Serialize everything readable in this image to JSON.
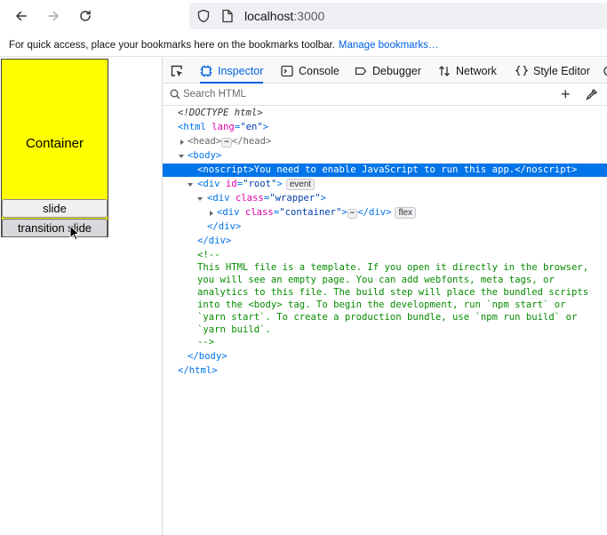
{
  "browser": {
    "url_host": "localhost",
    "url_port": ":3000",
    "bookmarks_text": "For quick access, place your bookmarks here on the bookmarks toolbar.",
    "bookmarks_link": "Manage bookmarks…"
  },
  "page": {
    "container_label": "Container",
    "slide_button": "slide",
    "transition_button": "transition slide",
    "container_color": "#ffff00"
  },
  "devtools": {
    "tabs": [
      "Inspector",
      "Console",
      "Debugger",
      "Network",
      "Style Editor"
    ],
    "active_tab": "Inspector",
    "search_placeholder": "Search HTML",
    "accent_color": "#0074e8",
    "tree": {
      "doctype": "<!DOCTYPE html>",
      "html_open_tag": "html",
      "html_lang_attr": "lang",
      "html_lang_val": "\"en\"",
      "head_tag": "head",
      "body_tag": "body",
      "noscript_line": "<noscript>You need to enable JavaScript to run this app.</noscript>",
      "root_tag": "div",
      "root_attr": "id",
      "root_val": "\"root\"",
      "root_badge": "event",
      "wrapper_tag": "div",
      "wrapper_attr": "class",
      "wrapper_val": "\"wrapper\"",
      "container_tag": "div",
      "container_attr": "class",
      "container_val": "\"container\"",
      "container_badge": "flex",
      "ellipsis": "⋯",
      "close_div": "</div>",
      "close_body": "</body>",
      "close_html": "</html>",
      "comment_open": "<!--",
      "comment_lines": [
        "This HTML file is a template. If you open it directly in the browser,",
        "you will see an empty page. You can add webfonts, meta tags, or",
        "analytics to this file. The build step will place the bundled scripts",
        "into the <body> tag. To begin the development, run `npm start` or",
        "`yarn start`. To create a production bundle, use `npm run build` or",
        "`yarn build`."
      ],
      "comment_close": "-->"
    }
  }
}
